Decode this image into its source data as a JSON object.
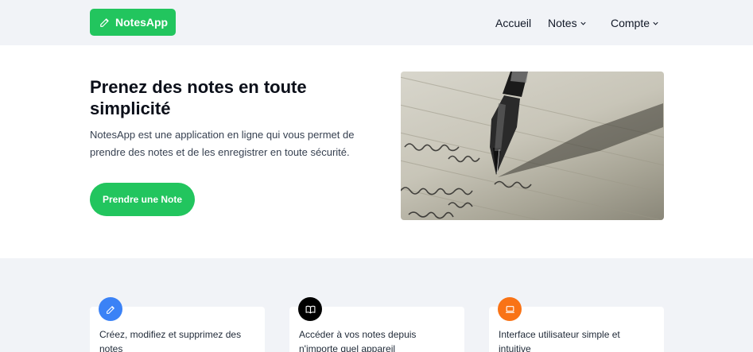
{
  "brand": {
    "name": "NotesApp",
    "icon": "pencil-icon",
    "color": "#22c55e"
  },
  "nav": {
    "home": "Accueil",
    "notes": "Notes",
    "account": "Compte"
  },
  "hero": {
    "title": "Prenez des notes en toute simplicité",
    "description": "NotesApp est une application en ligne qui vous permet de prendre des notes et de les enregistrer en toute sécurité.",
    "cta": "Prendre une Note",
    "image": "fountain-pen-writing-photo"
  },
  "features": [
    {
      "icon": "pencil-icon",
      "color": "#3b82f6",
      "text": "Créez, modifiez et supprimez des notes"
    },
    {
      "icon": "book-icon",
      "color": "#000000",
      "text": "Accéder à vos notes depuis n'importe quel appareil"
    },
    {
      "icon": "laptop-icon",
      "color": "#f97316",
      "text": "Interface utilisateur simple et intuitive"
    }
  ]
}
